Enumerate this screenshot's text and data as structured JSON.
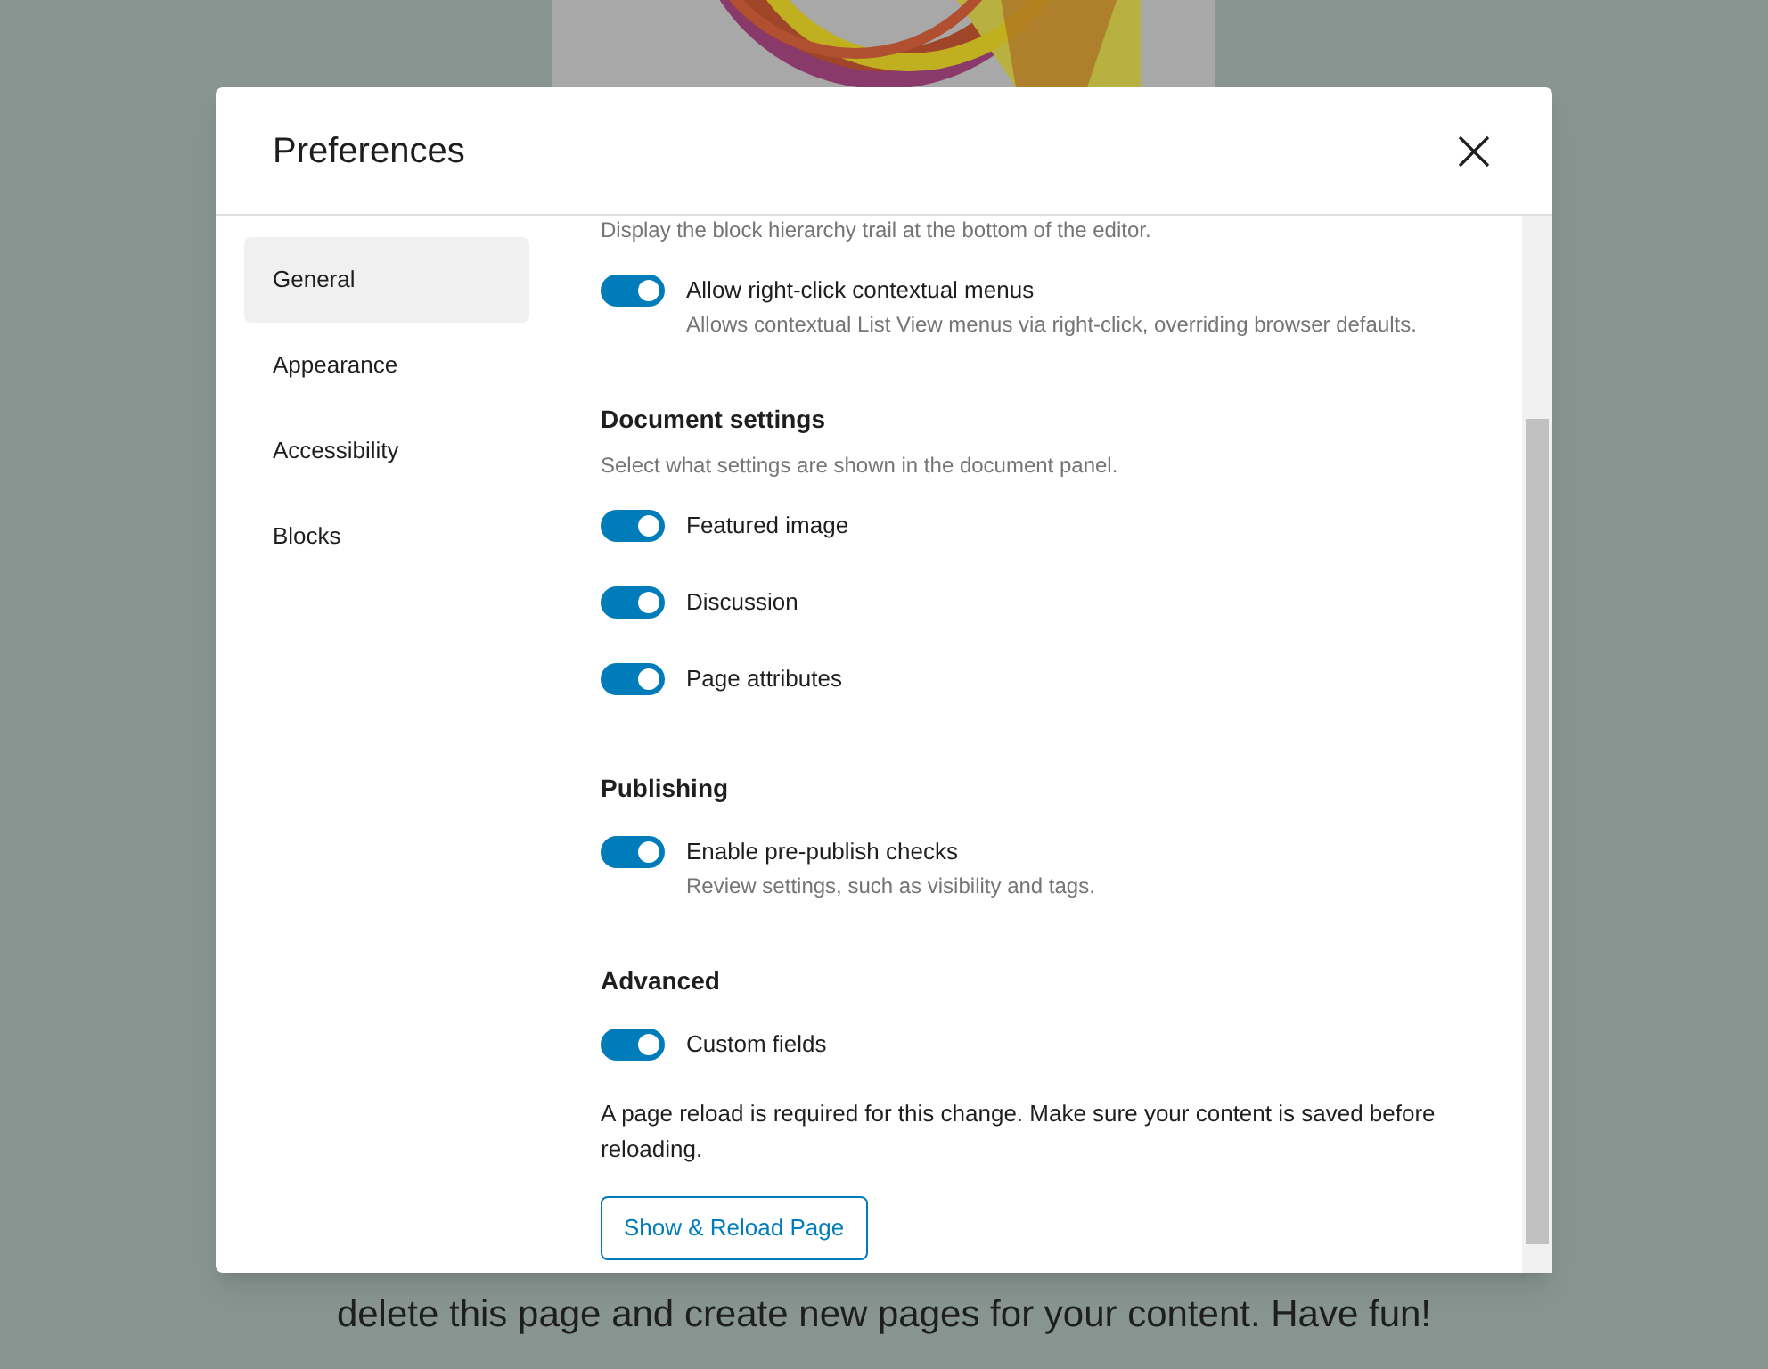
{
  "background": {
    "text": "delete this page and create new pages for your content. Have fun!"
  },
  "modal": {
    "title": "Preferences",
    "tabs": [
      {
        "label": "General",
        "selected": true
      },
      {
        "label": "Appearance",
        "selected": false
      },
      {
        "label": "Accessibility",
        "selected": false
      },
      {
        "label": "Blocks",
        "selected": false
      }
    ],
    "sections": [
      {
        "items": [
          {
            "kind": "note",
            "text": "Display the block hierarchy trail at the bottom of the editor."
          },
          {
            "kind": "toggle",
            "label": "Allow right-click contextual menus",
            "help": "Allows contextual List View menus via right-click, overriding browser defaults.",
            "on": true
          }
        ]
      },
      {
        "title": "Document settings",
        "description": "Select what settings are shown in the document panel.",
        "items": [
          {
            "kind": "toggle",
            "label": "Featured image",
            "on": true
          },
          {
            "kind": "toggle",
            "label": "Discussion",
            "on": true
          },
          {
            "kind": "toggle",
            "label": "Page attributes",
            "on": true
          }
        ]
      },
      {
        "title": "Publishing",
        "items": [
          {
            "kind": "toggle",
            "label": "Enable pre-publish checks",
            "help": "Review settings, such as visibility and tags.",
            "on": true
          }
        ]
      },
      {
        "title": "Advanced",
        "items": [
          {
            "kind": "toggle",
            "label": "Custom fields",
            "on": true
          },
          {
            "kind": "paragraph",
            "text": "A page reload is required for this change. Make sure your content is saved before reloading."
          },
          {
            "kind": "button",
            "label": "Show & Reload Page"
          }
        ]
      }
    ]
  }
}
